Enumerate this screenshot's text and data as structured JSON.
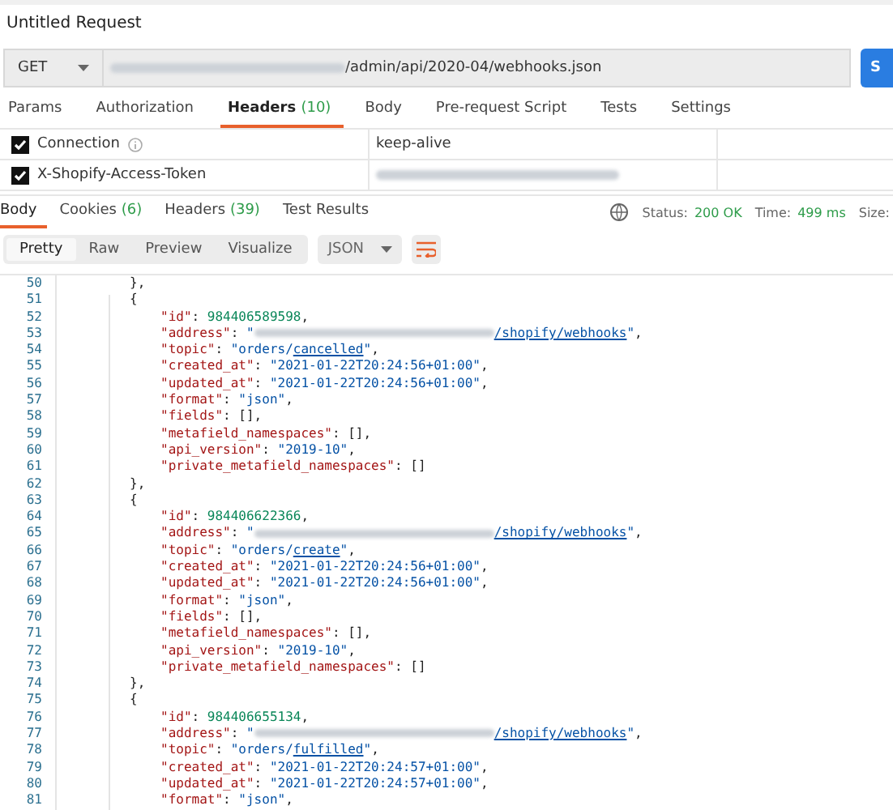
{
  "title": "Untitled Request",
  "request": {
    "method": "GET",
    "url_path": "/admin/api/2020-04/webhooks.json",
    "send": "S"
  },
  "request_tabs": [
    {
      "label": "Params",
      "selected": false
    },
    {
      "label": "Authorization",
      "selected": false
    },
    {
      "label": "Headers",
      "count": "(10)",
      "selected": true
    },
    {
      "label": "Body",
      "selected": false
    },
    {
      "label": "Pre-request Script",
      "selected": false
    },
    {
      "label": "Tests",
      "selected": false
    },
    {
      "label": "Settings",
      "selected": false
    }
  ],
  "headers": [
    {
      "key": "Connection",
      "info": true,
      "value": "keep-alive",
      "value_redacted": false,
      "checked": true
    },
    {
      "key": "X-Shopify-Access-Token",
      "info": false,
      "value_redacted": true,
      "checked": true
    }
  ],
  "response_tabs": [
    {
      "label": "Body",
      "selected": true
    },
    {
      "label": "Cookies",
      "count": "(6)",
      "selected": false
    },
    {
      "label": "Headers",
      "count": "(39)",
      "selected": false
    },
    {
      "label": "Test Results",
      "selected": false
    }
  ],
  "status": {
    "status_label": "Status:",
    "status": "200 OK",
    "time_label": "Time:",
    "time": "499 ms",
    "size_label": "Size:"
  },
  "view_modes": [
    {
      "label": "Pretty",
      "selected": true
    },
    {
      "label": "Raw",
      "selected": false
    },
    {
      "label": "Preview",
      "selected": false
    },
    {
      "label": "Visualize",
      "selected": false
    }
  ],
  "format": "JSON",
  "lines": [
    {
      "n": "50",
      "kind": "brace",
      "parts": [
        {
          "kind": "punct",
          "text": "},"
        }
      ]
    },
    {
      "n": "51",
      "kind": "brace",
      "parts": [
        {
          "kind": "punct",
          "text": "{"
        }
      ]
    },
    {
      "n": "52",
      "kind": "field",
      "parts": [
        {
          "kind": "key",
          "text": "\"id\""
        },
        {
          "kind": "punct",
          "text": ": "
        },
        {
          "kind": "number",
          "text": "984406589598"
        },
        {
          "kind": "punct",
          "text": ","
        }
      ]
    },
    {
      "n": "53",
      "kind": "field",
      "parts": [
        {
          "kind": "key",
          "text": "\"address\""
        },
        {
          "kind": "punct",
          "text": ": "
        },
        {
          "kind": "string",
          "text": "\""
        },
        {
          "kind": "redacted"
        },
        {
          "kind": "link",
          "text": "/shopify/webhooks"
        },
        {
          "kind": "string",
          "text": "\""
        },
        {
          "kind": "punct",
          "text": ","
        }
      ]
    },
    {
      "n": "54",
      "kind": "field",
      "parts": [
        {
          "kind": "key",
          "text": "\"topic\""
        },
        {
          "kind": "punct",
          "text": ": "
        },
        {
          "kind": "string",
          "text": "\"orders/"
        },
        {
          "kind": "link",
          "text": "cancelled"
        },
        {
          "kind": "string",
          "text": "\""
        },
        {
          "kind": "punct",
          "text": ","
        }
      ]
    },
    {
      "n": "55",
      "kind": "field",
      "parts": [
        {
          "kind": "key",
          "text": "\"created_at\""
        },
        {
          "kind": "punct",
          "text": ": "
        },
        {
          "kind": "string",
          "text": "\"2021-01-22T20:24:56+01:00\""
        },
        {
          "kind": "punct",
          "text": ","
        }
      ]
    },
    {
      "n": "56",
      "kind": "field",
      "parts": [
        {
          "kind": "key",
          "text": "\"updated_at\""
        },
        {
          "kind": "punct",
          "text": ": "
        },
        {
          "kind": "string",
          "text": "\"2021-01-22T20:24:56+01:00\""
        },
        {
          "kind": "punct",
          "text": ","
        }
      ]
    },
    {
      "n": "57",
      "kind": "field",
      "parts": [
        {
          "kind": "key",
          "text": "\"format\""
        },
        {
          "kind": "punct",
          "text": ": "
        },
        {
          "kind": "string",
          "text": "\"json\""
        },
        {
          "kind": "punct",
          "text": ","
        }
      ]
    },
    {
      "n": "58",
      "kind": "field",
      "parts": [
        {
          "kind": "key",
          "text": "\"fields\""
        },
        {
          "kind": "punct",
          "text": ": [],"
        }
      ]
    },
    {
      "n": "59",
      "kind": "field",
      "parts": [
        {
          "kind": "key",
          "text": "\"metafield_namespaces\""
        },
        {
          "kind": "punct",
          "text": ": [],"
        }
      ]
    },
    {
      "n": "60",
      "kind": "field",
      "parts": [
        {
          "kind": "key",
          "text": "\"api_version\""
        },
        {
          "kind": "punct",
          "text": ": "
        },
        {
          "kind": "string",
          "text": "\"2019-10\""
        },
        {
          "kind": "punct",
          "text": ","
        }
      ]
    },
    {
      "n": "61",
      "kind": "field",
      "parts": [
        {
          "kind": "key",
          "text": "\"private_metafield_namespaces\""
        },
        {
          "kind": "punct",
          "text": ": []"
        }
      ]
    },
    {
      "n": "62",
      "kind": "brace",
      "parts": [
        {
          "kind": "punct",
          "text": "},"
        }
      ]
    },
    {
      "n": "63",
      "kind": "brace",
      "parts": [
        {
          "kind": "punct",
          "text": "{"
        }
      ]
    },
    {
      "n": "64",
      "kind": "field",
      "parts": [
        {
          "kind": "key",
          "text": "\"id\""
        },
        {
          "kind": "punct",
          "text": ": "
        },
        {
          "kind": "number",
          "text": "984406622366"
        },
        {
          "kind": "punct",
          "text": ","
        }
      ]
    },
    {
      "n": "65",
      "kind": "field",
      "parts": [
        {
          "kind": "key",
          "text": "\"address\""
        },
        {
          "kind": "punct",
          "text": ": "
        },
        {
          "kind": "string",
          "text": "\""
        },
        {
          "kind": "redacted"
        },
        {
          "kind": "link",
          "text": "/shopify/webhooks"
        },
        {
          "kind": "string",
          "text": "\""
        },
        {
          "kind": "punct",
          "text": ","
        }
      ]
    },
    {
      "n": "66",
      "kind": "field",
      "parts": [
        {
          "kind": "key",
          "text": "\"topic\""
        },
        {
          "kind": "punct",
          "text": ": "
        },
        {
          "kind": "string",
          "text": "\"orders/"
        },
        {
          "kind": "link",
          "text": "create"
        },
        {
          "kind": "string",
          "text": "\""
        },
        {
          "kind": "punct",
          "text": ","
        }
      ]
    },
    {
      "n": "67",
      "kind": "field",
      "parts": [
        {
          "kind": "key",
          "text": "\"created_at\""
        },
        {
          "kind": "punct",
          "text": ": "
        },
        {
          "kind": "string",
          "text": "\"2021-01-22T20:24:56+01:00\""
        },
        {
          "kind": "punct",
          "text": ","
        }
      ]
    },
    {
      "n": "68",
      "kind": "field",
      "parts": [
        {
          "kind": "key",
          "text": "\"updated_at\""
        },
        {
          "kind": "punct",
          "text": ": "
        },
        {
          "kind": "string",
          "text": "\"2021-01-22T20:24:56+01:00\""
        },
        {
          "kind": "punct",
          "text": ","
        }
      ]
    },
    {
      "n": "69",
      "kind": "field",
      "parts": [
        {
          "kind": "key",
          "text": "\"format\""
        },
        {
          "kind": "punct",
          "text": ": "
        },
        {
          "kind": "string",
          "text": "\"json\""
        },
        {
          "kind": "punct",
          "text": ","
        }
      ]
    },
    {
      "n": "70",
      "kind": "field",
      "parts": [
        {
          "kind": "key",
          "text": "\"fields\""
        },
        {
          "kind": "punct",
          "text": ": [],"
        }
      ]
    },
    {
      "n": "71",
      "kind": "field",
      "parts": [
        {
          "kind": "key",
          "text": "\"metafield_namespaces\""
        },
        {
          "kind": "punct",
          "text": ": [],"
        }
      ]
    },
    {
      "n": "72",
      "kind": "field",
      "parts": [
        {
          "kind": "key",
          "text": "\"api_version\""
        },
        {
          "kind": "punct",
          "text": ": "
        },
        {
          "kind": "string",
          "text": "\"2019-10\""
        },
        {
          "kind": "punct",
          "text": ","
        }
      ]
    },
    {
      "n": "73",
      "kind": "field",
      "parts": [
        {
          "kind": "key",
          "text": "\"private_metafield_namespaces\""
        },
        {
          "kind": "punct",
          "text": ": []"
        }
      ]
    },
    {
      "n": "74",
      "kind": "brace",
      "parts": [
        {
          "kind": "punct",
          "text": "},"
        }
      ]
    },
    {
      "n": "75",
      "kind": "brace",
      "parts": [
        {
          "kind": "punct",
          "text": "{"
        }
      ]
    },
    {
      "n": "76",
      "kind": "field",
      "parts": [
        {
          "kind": "key",
          "text": "\"id\""
        },
        {
          "kind": "punct",
          "text": ": "
        },
        {
          "kind": "number",
          "text": "984406655134"
        },
        {
          "kind": "punct",
          "text": ","
        }
      ]
    },
    {
      "n": "77",
      "kind": "field",
      "parts": [
        {
          "kind": "key",
          "text": "\"address\""
        },
        {
          "kind": "punct",
          "text": ": "
        },
        {
          "kind": "string",
          "text": "\""
        },
        {
          "kind": "redacted"
        },
        {
          "kind": "link",
          "text": "/shopify/webhooks"
        },
        {
          "kind": "string",
          "text": "\""
        },
        {
          "kind": "punct",
          "text": ","
        }
      ]
    },
    {
      "n": "78",
      "kind": "field",
      "parts": [
        {
          "kind": "key",
          "text": "\"topic\""
        },
        {
          "kind": "punct",
          "text": ": "
        },
        {
          "kind": "string",
          "text": "\"orders/"
        },
        {
          "kind": "link",
          "text": "fulfilled"
        },
        {
          "kind": "string",
          "text": "\""
        },
        {
          "kind": "punct",
          "text": ","
        }
      ]
    },
    {
      "n": "79",
      "kind": "field",
      "parts": [
        {
          "kind": "key",
          "text": "\"created_at\""
        },
        {
          "kind": "punct",
          "text": ": "
        },
        {
          "kind": "string",
          "text": "\"2021-01-22T20:24:57+01:00\""
        },
        {
          "kind": "punct",
          "text": ","
        }
      ]
    },
    {
      "n": "80",
      "kind": "field",
      "parts": [
        {
          "kind": "key",
          "text": "\"updated_at\""
        },
        {
          "kind": "punct",
          "text": ": "
        },
        {
          "kind": "string",
          "text": "\"2021-01-22T20:24:57+01:00\""
        },
        {
          "kind": "punct",
          "text": ","
        }
      ]
    },
    {
      "n": "81",
      "kind": "field",
      "parts": [
        {
          "kind": "key",
          "text": "\"format\""
        },
        {
          "kind": "punct",
          "text": ": "
        },
        {
          "kind": "string",
          "text": "\"json\""
        },
        {
          "kind": "punct",
          "text": ","
        }
      ]
    }
  ]
}
